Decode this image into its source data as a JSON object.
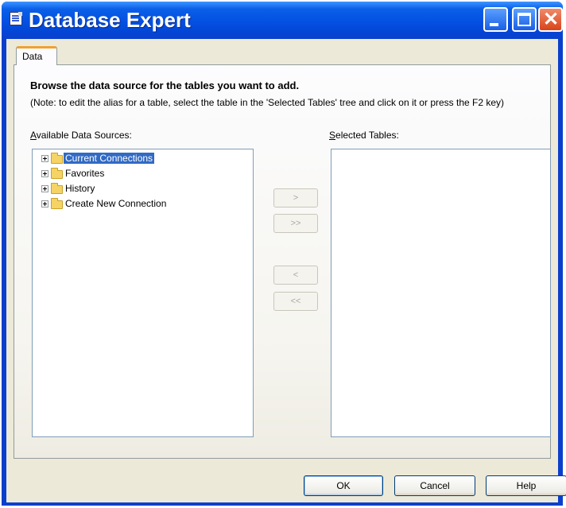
{
  "window": {
    "title": "Database Expert"
  },
  "tabs": [
    {
      "label": "Data",
      "active": true
    }
  ],
  "panel": {
    "heading": "Browse the data source for the tables you want to add.",
    "note": "(Note: to edit the alias for a table, select the table in the 'Selected Tables' tree and click on it or press the F2 key)",
    "available_label_accel": "A",
    "available_label_rest": "vailable Data Sources:",
    "selected_label_accel": "S",
    "selected_label_rest": "elected Tables:"
  },
  "tree": [
    {
      "label": "Current Connections",
      "selected": true,
      "icon": "folder-icon"
    },
    {
      "label": "Favorites",
      "selected": false,
      "icon": "folder-icon"
    },
    {
      "label": "History",
      "selected": false,
      "icon": "folder-icon"
    },
    {
      "label": "Create New Connection",
      "selected": false,
      "icon": "folder-icon"
    }
  ],
  "selected_tables": [],
  "movers": {
    "add": ">",
    "add_all": ">>",
    "remove": "<",
    "remove_all": "<<"
  },
  "buttons": {
    "ok": "OK",
    "cancel": "Cancel",
    "help": "Help"
  },
  "colors": {
    "title_bar": "#0450e2",
    "selection": "#316ac5",
    "dialog_bg": "#ece9d8",
    "folder": "#f6d365"
  }
}
